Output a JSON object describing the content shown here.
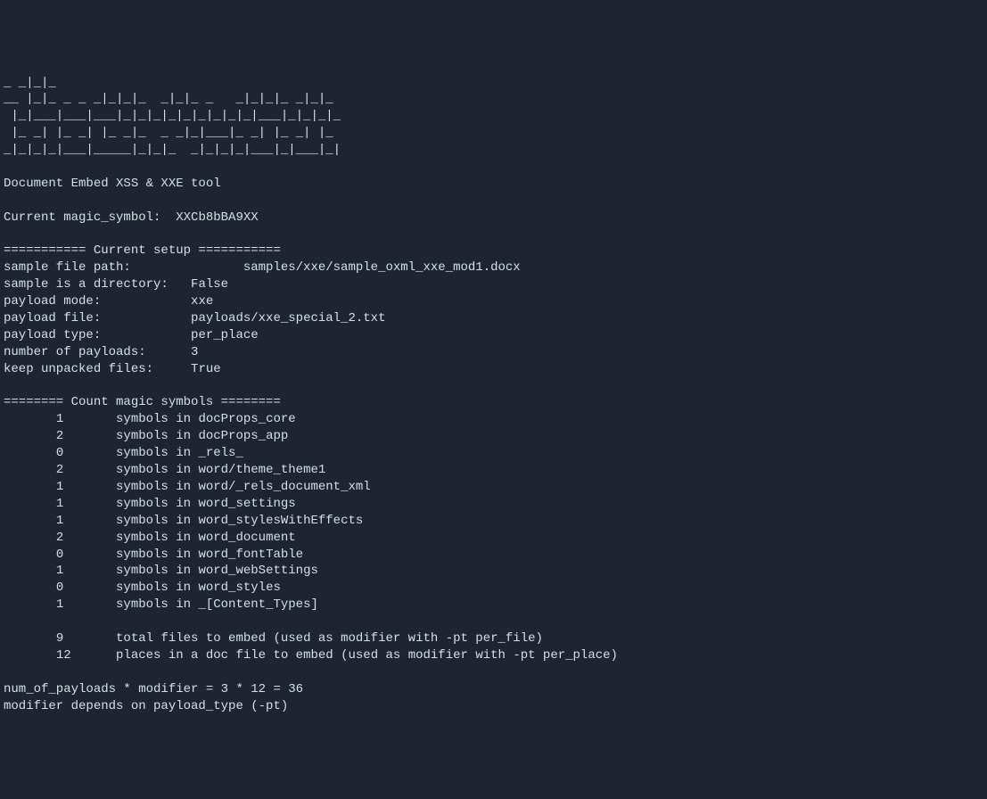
{
  "ascii_art": "_ _|_|_\n__ |_|_ _ _ _|_|_|_  _|_|_ _   _|_|_|_ _|_|_\n |_|___|___|___|_|_|_|_|_|_|_|_|_|___|_|_|_|_\n |_ _| |_ _| |_ _|_  _ _|_|___|_ _| |_ _| |_\n_|_|_|_|___|_____|_|_|_  _|_|_|_|___|_|___|_|",
  "tool_name": "Document Embed XSS & XXE tool",
  "magic_symbol": {
    "label": "Current magic_symbol:  ",
    "value": "XXCb8bBA9XX"
  },
  "setup": {
    "header": "=========== Current setup ===========",
    "items": [
      {
        "label": "sample file path:               ",
        "value": "samples/xxe/sample_oxml_xxe_mod1.docx"
      },
      {
        "label": "sample is a directory:   ",
        "value": "False"
      },
      {
        "label": "payload mode:            ",
        "value": "xxe"
      },
      {
        "label": "payload file:            ",
        "value": "payloads/xxe_special_2.txt"
      },
      {
        "label": "payload type:            ",
        "value": "per_place"
      },
      {
        "label": "number of payloads:      ",
        "value": "3"
      },
      {
        "label": "keep unpacked files:     ",
        "value": "True"
      }
    ]
  },
  "count_section": {
    "header": "======== Count magic symbols ========",
    "symbols": [
      {
        "count": "1",
        "name": "docProps_core"
      },
      {
        "count": "2",
        "name": "docProps_app"
      },
      {
        "count": "0",
        "name": "_rels_"
      },
      {
        "count": "2",
        "name": "word/theme_theme1"
      },
      {
        "count": "1",
        "name": "word/_rels_document_xml"
      },
      {
        "count": "1",
        "name": "word_settings"
      },
      {
        "count": "1",
        "name": "word_stylesWithEffects"
      },
      {
        "count": "2",
        "name": "word_document"
      },
      {
        "count": "0",
        "name": "word_fontTable"
      },
      {
        "count": "1",
        "name": "word_webSettings"
      },
      {
        "count": "0",
        "name": "word_styles"
      },
      {
        "count": "1",
        "name": "_[Content_Types]"
      }
    ],
    "totals": [
      {
        "count": "9",
        "text": "total files to embed (used as modifier with -pt per_file)"
      },
      {
        "count": "12",
        "text": "places in a doc file to embed (used as modifier with -pt per_place)"
      }
    ]
  },
  "calculation": {
    "line1": "num_of_payloads * modifier = 3 * 12 = 36",
    "line2": "modifier depends on payload_type (-pt)"
  }
}
